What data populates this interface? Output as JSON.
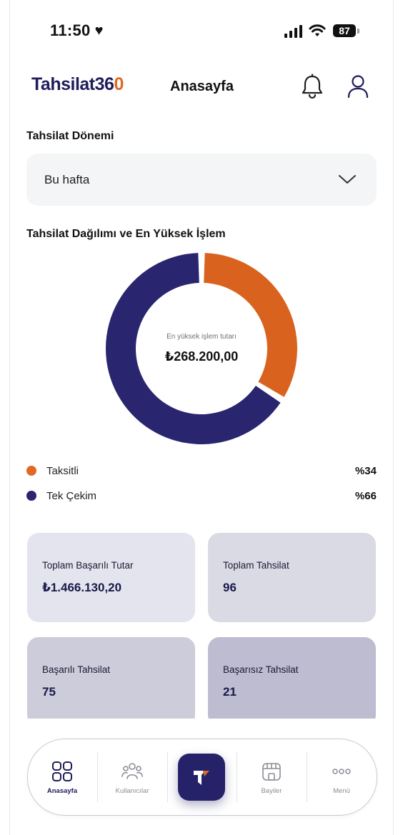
{
  "status_bar": {
    "time": "11:50",
    "battery": "87"
  },
  "header": {
    "logo_main": "Tahsilat36",
    "logo_accent": "0",
    "title": "Anasayfa"
  },
  "period": {
    "label": "Tahsilat Dönemi",
    "selected": "Bu hafta"
  },
  "distribution": {
    "title": "Tahsilat Dağılımı ve En Yüksek İşlem",
    "center_caption": "En yüksek işlem tutarı",
    "center_value": "₺268.200,00",
    "segments": [
      {
        "name": "Taksitli",
        "percent_label": "%34",
        "value": 34,
        "color": "#d9631e"
      },
      {
        "name": "Tek Çekim",
        "percent_label": "%66",
        "value": 66,
        "color": "#2a256f"
      }
    ]
  },
  "cards": [
    {
      "title": "Toplam Başarılı Tutar",
      "value": "₺1.466.130,20",
      "bg": "#e4e4ee"
    },
    {
      "title": "Toplam Tahsilat",
      "value": "96",
      "bg": "#dadae5"
    },
    {
      "title": "Başarılı Tahsilat",
      "value": "75",
      "bg": "#ccccda"
    },
    {
      "title": "Başarısız Tahsilat",
      "value": "21",
      "bg": "#bdbcd1"
    }
  ],
  "nav": {
    "items": [
      {
        "label": "Anasayfa",
        "icon": "grid-icon",
        "active": true
      },
      {
        "label": "Kullanıcılar",
        "icon": "users-icon",
        "active": false
      },
      {
        "label": "",
        "icon": "app-logo-icon",
        "active": false
      },
      {
        "label": "Bayiler",
        "icon": "store-icon",
        "active": false
      },
      {
        "label": "Menü",
        "icon": "more-icon",
        "active": false
      }
    ]
  },
  "colors": {
    "brand_navy": "#25226a",
    "brand_orange": "#e06a22"
  }
}
